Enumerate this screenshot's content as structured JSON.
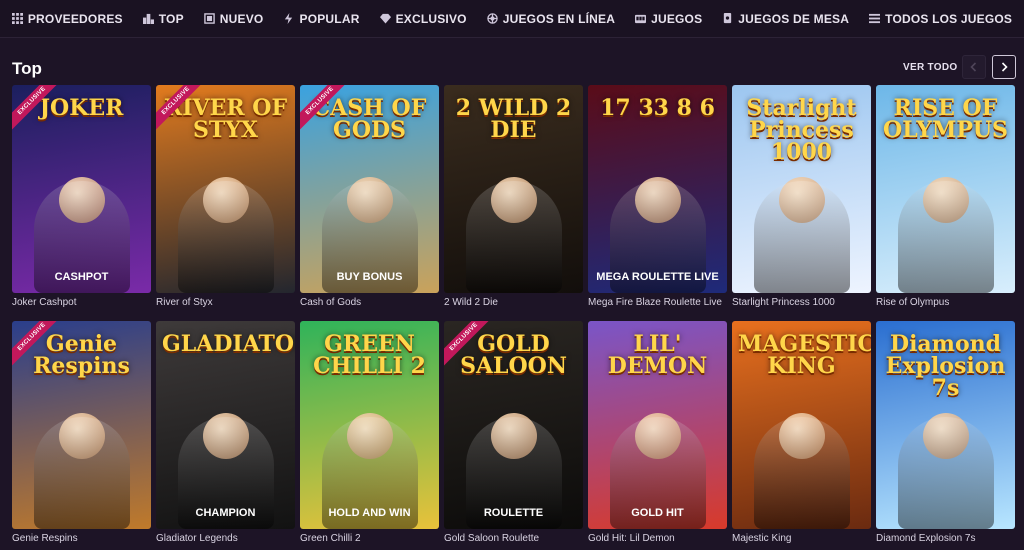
{
  "nav": [
    {
      "label": "PROVEEDORES",
      "icon": "grid-icon"
    },
    {
      "label": "TOP",
      "icon": "podium-icon"
    },
    {
      "label": "NUEVO",
      "icon": "new-icon"
    },
    {
      "label": "POPULAR",
      "icon": "lightning-icon"
    },
    {
      "label": "EXCLUSIVO",
      "icon": "diamond-icon"
    },
    {
      "label": "JUEGOS EN LÍNEA",
      "icon": "roulette-icon"
    },
    {
      "label": "JUEGOS",
      "icon": "slot-machine-icon"
    },
    {
      "label": "JUEGOS DE MESA",
      "icon": "cards-icon"
    },
    {
      "label": "TODOS LOS JUEGOS",
      "icon": "list-icon"
    }
  ],
  "section": {
    "title": "Top",
    "see_all": "VER TODO"
  },
  "games": [
    {
      "name": "Joker Cashpot",
      "art_title": "JOKER",
      "art_sub": "CASHPOT",
      "exclusive": true,
      "colors": [
        "#1b1f5e",
        "#7a2aa8"
      ]
    },
    {
      "name": "River of Styx",
      "art_title": "RIVER OF STYX",
      "art_sub": "",
      "exclusive": true,
      "colors": [
        "#e27b1e",
        "#23262e"
      ]
    },
    {
      "name": "Cash of Gods",
      "art_title": "CASH OF GODS",
      "art_sub": "BUY BONUS",
      "exclusive": true,
      "colors": [
        "#3aa2e0",
        "#caa25a"
      ]
    },
    {
      "name": "2 Wild 2 Die",
      "art_title": "2 WILD 2 DIE",
      "art_sub": "",
      "exclusive": false,
      "colors": [
        "#3a2c1e",
        "#120e0b"
      ]
    },
    {
      "name": "Mega Fire Blaze Roulette Live",
      "art_title": "17  33  8  6",
      "art_sub": "MEGA ROULETTE LIVE",
      "exclusive": false,
      "colors": [
        "#5a0c18",
        "#1e2a7a"
      ]
    },
    {
      "name": "Starlight Princess 1000",
      "art_title": "Starlight Princess 1000",
      "art_sub": "",
      "exclusive": false,
      "colors": [
        "#9cc6f0",
        "#eef4ff"
      ]
    },
    {
      "name": "Rise of Olympus",
      "art_title": "RISE OF OLYMPUS",
      "art_sub": "",
      "exclusive": false,
      "colors": [
        "#6db7e8",
        "#d8eefc"
      ]
    },
    {
      "name": "Genie Respins",
      "art_title": "Genie Respins",
      "art_sub": "",
      "exclusive": true,
      "colors": [
        "#2a3e8c",
        "#c07a2a"
      ]
    },
    {
      "name": "Gladiator Legends",
      "art_title": "GLADIATOR",
      "art_sub": "CHAMPION",
      "exclusive": false,
      "colors": [
        "#3e3a3a",
        "#121212"
      ]
    },
    {
      "name": "Green Chilli 2",
      "art_title": "GREEN CHILLI 2",
      "art_sub": "HOLD AND WIN",
      "exclusive": false,
      "colors": [
        "#2fb35a",
        "#e9c23a"
      ]
    },
    {
      "name": "Gold Saloon Roulette",
      "art_title": "GOLD SALOON",
      "art_sub": "ROULETTE",
      "exclusive": true,
      "colors": [
        "#2a2622",
        "#0c0b0a"
      ]
    },
    {
      "name": "Gold Hit: Lil Demon",
      "art_title": "LIL' DEMON",
      "art_sub": "GOLD HIT",
      "exclusive": false,
      "colors": [
        "#7a55c8",
        "#d83a2a"
      ]
    },
    {
      "name": "Majestic King",
      "art_title": "MAGESTIC KING",
      "art_sub": "",
      "exclusive": false,
      "colors": [
        "#e8701e",
        "#6a2a10"
      ]
    },
    {
      "name": "Diamond Explosion 7s",
      "art_title": "Diamond Explosion 7s",
      "art_sub": "",
      "exclusive": false,
      "colors": [
        "#2a6ed0",
        "#b8e6ff"
      ]
    }
  ]
}
